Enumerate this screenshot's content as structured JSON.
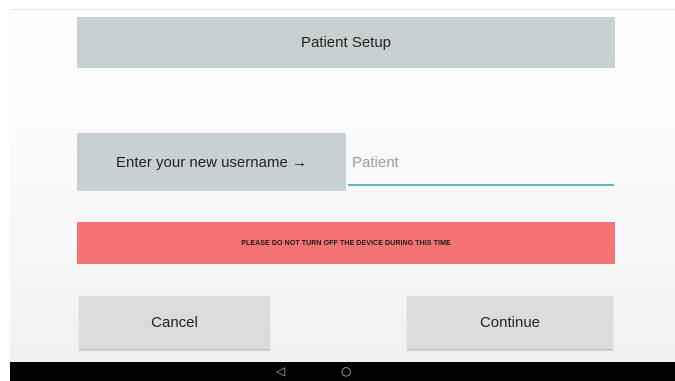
{
  "header": {
    "title": "Patient Setup"
  },
  "username_form": {
    "label": "Enter your new username →",
    "input_placeholder": "Patient",
    "input_value": ""
  },
  "warning": {
    "text": "PLEASE DO NOT TURN OFF THE DEVICE DURING THIS TIME"
  },
  "actions": {
    "cancel_label": "Cancel",
    "continue_label": "Continue"
  },
  "navbar": {
    "back_icon": "back-triangle-icon",
    "home_icon": "home-circle-icon"
  },
  "colors": {
    "panel": "#c9d0d1",
    "warning": "#f67373",
    "input_underline": "#5bb8c9",
    "button": "#dcdcdc"
  }
}
